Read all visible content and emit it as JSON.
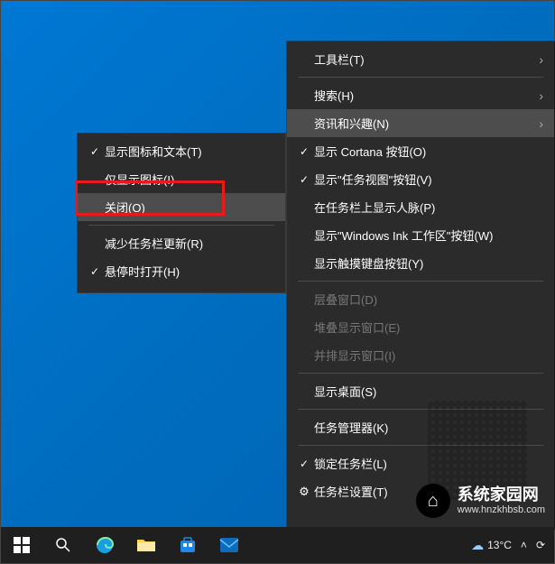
{
  "mainMenu": {
    "toolbar": {
      "label": "工具栏(T)",
      "arrow": true
    },
    "search": {
      "label": "搜索(H)",
      "arrow": true
    },
    "news": {
      "label": "资讯和兴趣(N)",
      "arrow": true,
      "hovered": true
    },
    "cortana": {
      "label": "显示 Cortana 按钮(O)",
      "checked": true
    },
    "taskview": {
      "label": "显示\"任务视图\"按钮(V)",
      "checked": true
    },
    "people": {
      "label": "在任务栏上显示人脉(P)"
    },
    "ink": {
      "label": "显示\"Windows Ink 工作区\"按钮(W)"
    },
    "touchkb": {
      "label": "显示触摸键盘按钮(Y)"
    },
    "cascade": {
      "label": "层叠窗口(D)",
      "disabled": true
    },
    "stacked": {
      "label": "堆叠显示窗口(E)",
      "disabled": true
    },
    "sidebyside": {
      "label": "并排显示窗口(I)",
      "disabled": true
    },
    "showdesktop": {
      "label": "显示桌面(S)"
    },
    "taskmgr": {
      "label": "任务管理器(K)"
    },
    "lock": {
      "label": "锁定任务栏(L)",
      "checked": true
    },
    "settings": {
      "label": "任务栏设置(T)",
      "gear": true
    }
  },
  "subMenu": {
    "iconAndText": {
      "label": "显示图标和文本(T)",
      "checked": true
    },
    "iconOnly": {
      "label": "仅显示图标(I)"
    },
    "off": {
      "label": "关闭(O)",
      "hovered": true
    },
    "reduce": {
      "label": "减少任务栏更新(R)"
    },
    "hoverOpen": {
      "label": "悬停时打开(H)",
      "checked": true
    }
  },
  "taskbar": {
    "weatherTemp": "13°C",
    "overflowChevron": "˄"
  },
  "watermark": {
    "title": "系统家园网",
    "url": "www.hnzkhbsb.com"
  }
}
